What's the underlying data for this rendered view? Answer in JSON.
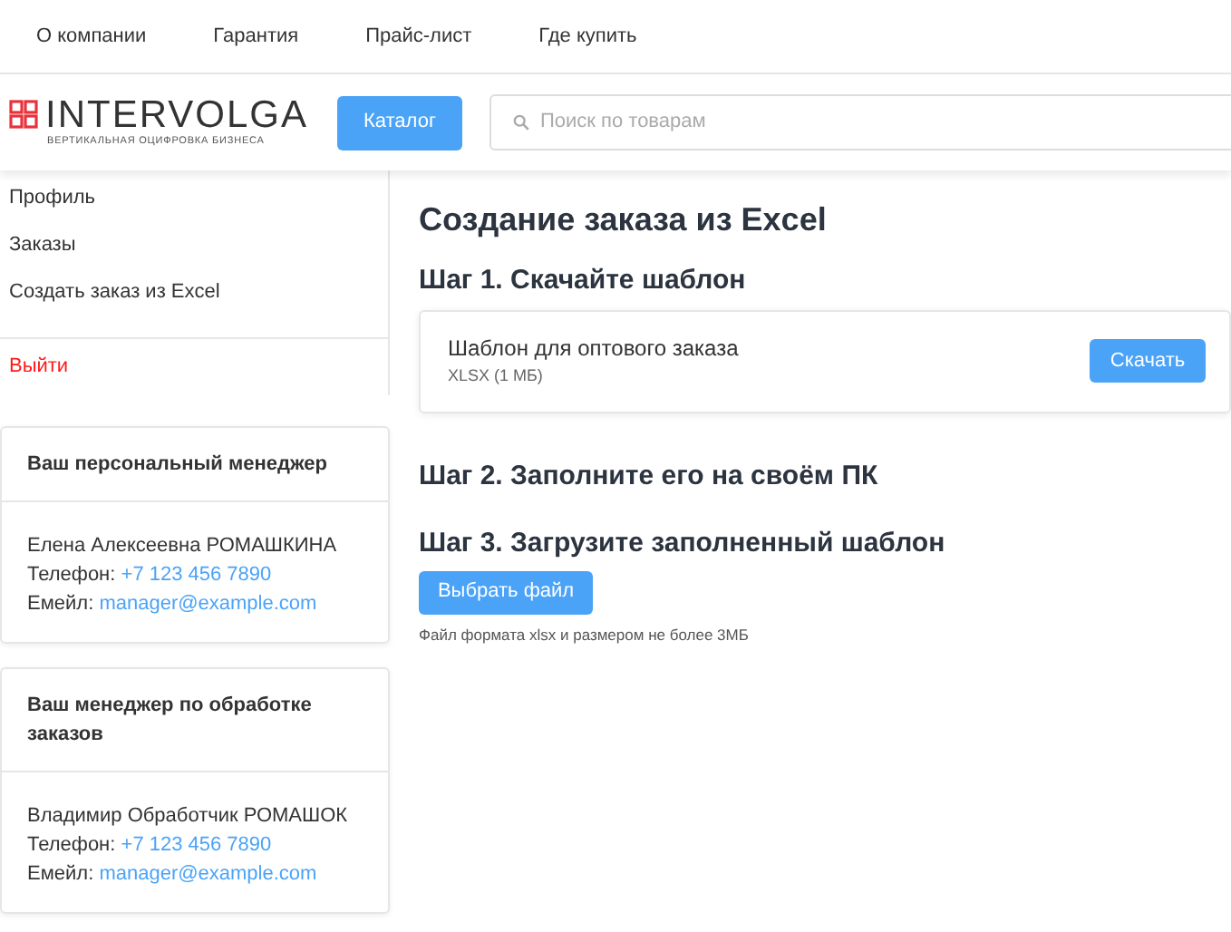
{
  "top_nav": [
    "О компании",
    "Гарантия",
    "Прайс-лист",
    "Где купить"
  ],
  "header": {
    "logo": {
      "name": "INTERVOLGA",
      "tagline": "ВЕРТИКАЛЬНАЯ ОЦИФРОВКА БИЗНЕСА"
    },
    "catalog_button": "Каталог",
    "search": {
      "placeholder": "Поиск по товарам"
    }
  },
  "sidebar": {
    "menu": [
      {
        "label": "Профиль",
        "kind": "link"
      },
      {
        "label": "Заказы",
        "kind": "link"
      },
      {
        "label": "Создать заказ из Excel",
        "kind": "link"
      },
      {
        "label": "Выйти",
        "kind": "logout"
      }
    ],
    "managers": [
      {
        "title": "Ваш персональный менеджер",
        "name": "Елена Алексеевна РОМАШКИНА",
        "phone_label": "Телефон:",
        "phone": "+7 123 456 7890",
        "email_label": "Емейл:",
        "email": "manager@example.com"
      },
      {
        "title": "Ваш менеджер по обработке заказов",
        "name": "Владимир Обработчик РОМАШОК",
        "phone_label": "Телефон:",
        "phone": "+7 123 456 7890",
        "email_label": "Емейл:",
        "email": "manager@example.com"
      }
    ]
  },
  "main": {
    "title": "Создание заказа из Excel",
    "step1": {
      "heading": "Шаг 1. Скачайте шаблон",
      "file": {
        "name": "Шаблон для оптового заказа",
        "meta": "XLSX (1 МБ)",
        "button": "Скачать"
      }
    },
    "step2": {
      "heading": "Шаг 2. Заполните его на своём ПК"
    },
    "step3": {
      "heading": "Шаг 3. Загрузите заполненный шаблон",
      "button": "Выбрать файл",
      "note": "Файл формата xlsx и размером не более 3МБ"
    }
  }
}
